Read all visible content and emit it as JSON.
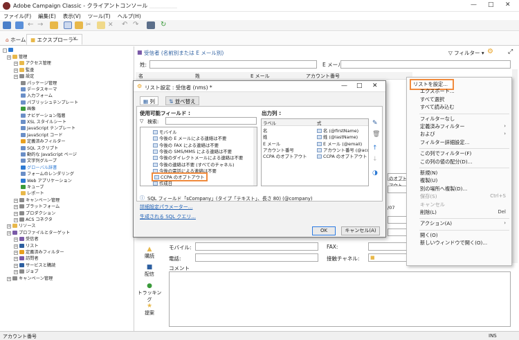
{
  "window": {
    "title": "Adobe Campaign Classic - クライアントコンソール",
    "user_blur": "＿＿＿＿＿"
  },
  "menu": [
    "ファイル(F)",
    "編集(E)",
    "表示(V)",
    "ツール(T)",
    "ヘルプ(H)"
  ],
  "tabs": {
    "home": "ホーム",
    "explorer": "エクスプローラー"
  },
  "tree": [
    {
      "label": "管理",
      "level": 0,
      "icon": "folder"
    },
    {
      "label": "アクセス管理",
      "level": 1,
      "icon": "folder"
    },
    {
      "label": "監査",
      "level": 1,
      "icon": "folder"
    },
    {
      "label": "設定",
      "level": 1,
      "icon": "gear"
    },
    {
      "label": "パッケージ管理",
      "level": 2,
      "icon": "gear"
    },
    {
      "label": "データスキーマ",
      "level": 2,
      "icon": "schema"
    },
    {
      "label": "入力フォーム",
      "level": 2,
      "icon": "schema"
    },
    {
      "label": "パブリッシュテンプレート",
      "level": 2,
      "icon": "schema"
    },
    {
      "label": "画像",
      "level": 2,
      "icon": "image"
    },
    {
      "label": "ナビゲーション階層",
      "level": 2,
      "icon": "schema"
    },
    {
      "label": "XSL スタイルシート",
      "level": 2,
      "icon": "schema"
    },
    {
      "label": "JavaScript テンプレート",
      "level": 2,
      "icon": "schema"
    },
    {
      "label": "JavaScript コード",
      "level": 2,
      "icon": "schema"
    },
    {
      "label": "定義済みフィルター",
      "level": 2,
      "icon": "filter"
    },
    {
      "label": "SQL スクリプト",
      "level": 2,
      "icon": "schema"
    },
    {
      "label": "動的な JavaScript ページ",
      "level": 2,
      "icon": "schema"
    },
    {
      "label": "文字列グループ",
      "level": 2,
      "icon": "schema"
    },
    {
      "label": "グローバル辞書",
      "level": 2,
      "icon": "globe"
    },
    {
      "label": "フォームのレンダリング",
      "level": 2,
      "icon": "schema"
    },
    {
      "label": "Web アプリケーション",
      "level": 2,
      "icon": "globe"
    },
    {
      "label": "キューブ",
      "level": 2,
      "icon": "cube"
    },
    {
      "label": "レポート",
      "level": 2,
      "icon": "folder"
    },
    {
      "label": "キャンペーン管理",
      "level": 1,
      "icon": "gear"
    },
    {
      "label": "プラットフォーム",
      "level": 1,
      "icon": "gear"
    },
    {
      "label": "プロダクション",
      "level": 1,
      "icon": "gear"
    },
    {
      "label": "ACS コネクタ",
      "level": 1,
      "icon": "gear"
    },
    {
      "label": "リソース",
      "level": 0,
      "icon": "folder"
    },
    {
      "label": "プロファイルとターゲット",
      "level": 0,
      "icon": "people"
    },
    {
      "label": "受信者",
      "level": 1,
      "icon": "people"
    },
    {
      "label": "リスト",
      "level": 1,
      "icon": "list"
    },
    {
      "label": "定義済みフィルター",
      "level": 1,
      "icon": "filter"
    },
    {
      "label": "訪問者",
      "level": 1,
      "icon": "people"
    },
    {
      "label": "サービスと購読",
      "level": 1,
      "icon": "list"
    },
    {
      "label": "ジョブ",
      "level": 1,
      "icon": "gear"
    },
    {
      "label": "キャンペーン管理",
      "level": 0,
      "icon": "gear"
    }
  ],
  "recipients": {
    "header": "受信者 (名前別または E メール別)",
    "filter_button": "フィルター",
    "name_label": "姓:",
    "email_label": "E メール:",
    "columns": [
      "名",
      "姓",
      "E メール",
      "アカウント番号"
    ]
  },
  "form": {
    "mobile_label": "モバイル:",
    "phone_label": "電話:",
    "fax_label": "FAX:",
    "channel_label": "接触チャネル:",
    "comment_label": "コメント",
    "opt_out": "のオプトアウト",
    "date_frag": "/07",
    "side_tabs": [
      "購読",
      "配信",
      "トラッキング",
      "提案"
    ]
  },
  "dialog": {
    "title": "リスト設定 : 受信者 (nms) *",
    "tab_columns": "列",
    "tab_sort": "並べ替え",
    "available_label": "使用可能フィールド :",
    "search_label": "検索:",
    "output_label": "出力列 :",
    "available_fields": [
      "モバイル",
      "今後の E メールによる連絡は不要",
      "今後の FAX による連絡は不要",
      "今後の SMS/MMS による連絡は不要",
      "今後のダイレクトメールによる連絡は不要",
      "今後の連絡は不要 (すべてのチャネル)",
      "今後の電話による連絡は不要",
      "CCPA のオプトアウト",
      "作成日"
    ],
    "output_headers": [
      "ラベル",
      "式"
    ],
    "output_columns": [
      {
        "label": "名",
        "expr": "名 (@firstName)"
      },
      {
        "label": "姓",
        "expr": "姓 (@lastName)"
      },
      {
        "label": "E メール",
        "expr": "E メール (@email)"
      },
      {
        "label": "アカウント番号",
        "expr": "アカウント番号 (@acc"
      },
      {
        "label": "CCPA のオプトアウト",
        "expr": "CCPA のオプトアウト"
      }
    ],
    "field_info": "SQL フィールド「sCompany」(タイプ「テキスト」、長さ 80) (@company)",
    "link_advanced": "詳細設定パラメーター...",
    "link_sql": "生成される SQL クエリ...",
    "ok": "OK",
    "cancel": "キャンセル(A)"
  },
  "context_menu": [
    {
      "label": "リストを設定...",
      "highlight": true
    },
    {
      "label": "エクスポート..."
    },
    {
      "label": "すべて選択"
    },
    {
      "label": "すべて読み込む"
    },
    {
      "sep": true
    },
    {
      "label": "フィルターなし"
    },
    {
      "label": "定義済みフィルター",
      "arrow": true
    },
    {
      "label": "および",
      "arrow": true
    },
    {
      "label": "フィルター詳細設定..."
    },
    {
      "sep": true
    },
    {
      "label": "この列でフィルター(F)"
    },
    {
      "label": "この列の値の配分(D)..."
    },
    {
      "sep": true
    },
    {
      "label": "新規(N)"
    },
    {
      "label": "複製(U)"
    },
    {
      "label": "別の場所へ複製(D)..."
    },
    {
      "label": "保存(S)",
      "key": "Ctrl+S",
      "disabled": true
    },
    {
      "label": "キャンセル",
      "disabled": true
    },
    {
      "label": "削除(L)",
      "key": "Del"
    },
    {
      "sep": true
    },
    {
      "label": "アクション(A)",
      "arrow": true
    },
    {
      "sep": true
    },
    {
      "label": "開く(O)"
    },
    {
      "label": "新しいウィンドウで開く(O)..."
    }
  ],
  "status": {
    "left": "アカウント番号",
    "ins": "INS"
  },
  "colors": {
    "accent": "#f08a3c",
    "link": "#1c5fb5",
    "folder": "#e8b84a"
  }
}
